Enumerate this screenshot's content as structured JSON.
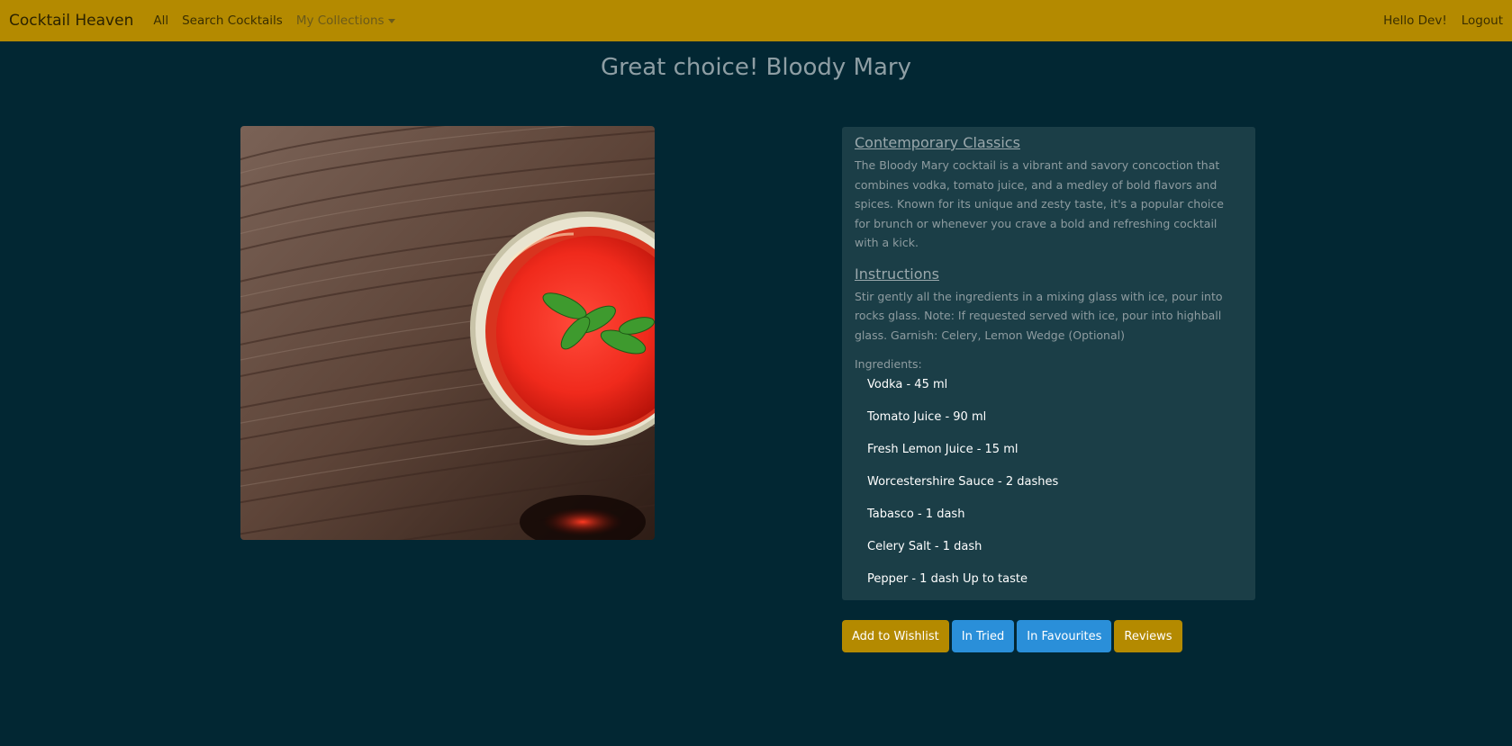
{
  "nav": {
    "brand": "Cocktail Heaven",
    "all": "All",
    "search": "Search Cocktails",
    "collections": "My Collections",
    "greeting": "Hello Dev!",
    "logout": "Logout"
  },
  "page": {
    "title": "Great choice! Bloody Mary"
  },
  "details": {
    "category": "Contemporary Classics",
    "description": "The Bloody Mary cocktail is a vibrant and savory concoction that combines vodka, tomato juice, and a medley of bold flavors and spices. Known for its unique and zesty taste, it's a popular choice for brunch or whenever you crave a bold and refreshing cocktail with a kick.",
    "instructions_heading": "Instructions",
    "instructions": "Stir gently all the ingredients in a mixing glass with ice, pour into rocks glass. Note: If requested served with ice, pour into highball glass. Garnish: Celery, Lemon Wedge (Optional)",
    "ingredients_label": "Ingredients:",
    "ingredients": [
      "Vodka - 45 ml",
      "Tomato Juice - 90 ml",
      "Fresh Lemon Juice - 15 ml",
      "Worcestershire Sauce - 2 dashes",
      "Tabasco - 1 dash",
      "Celery Salt - 1 dash",
      "Pepper - 1 dash Up to taste"
    ]
  },
  "actions": {
    "wishlist": "Add to Wishlist",
    "tried": "In Tried",
    "favourites": "In Favourites",
    "reviews": "Reviews"
  },
  "colors": {
    "navbar": "#b48a00",
    "background": "#022733",
    "panel": "#1b3e47",
    "button_gold": "#b48a00",
    "button_blue": "#2a8fd9"
  }
}
